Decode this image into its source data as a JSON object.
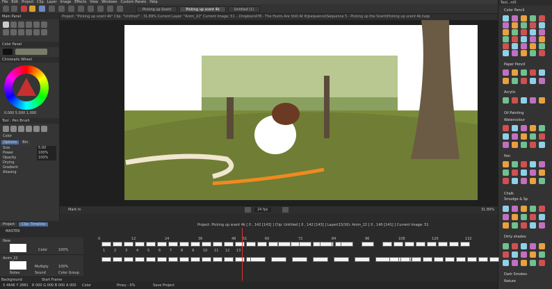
{
  "menu": [
    "File",
    "Edit",
    "Project",
    "Clip",
    "Layer",
    "Image",
    "Effects",
    "View",
    "Windows",
    "Custom Panels",
    "Help"
  ],
  "tabs": [
    "Picking up Scent",
    "Picking up scent 4k",
    "Untitled (1)"
  ],
  "status_line": "Project: \"Picking up scent 4k\" Clip: \"Untitled\" : 31.89% Current Layer: \"Anim_22\" Current Image: 51 ...Dropbox\\478 - The Hunts Are Shill At It\\Jsequence\\Sequence 5 - Picking up the Scent\\Picking up scent 4k.tvpp",
  "left_panel": {
    "main_panel": "Main Panel",
    "color_panel": "Color Panel",
    "chromatic_wheel": "Chromatic Wheel",
    "coords": "0.000 5.000 1.000",
    "tool_title": "Tool : Pen Brush",
    "color_label": "Color",
    "options_tab": "Options",
    "bin_tab": "Bin",
    "props": [
      {
        "label": "Size",
        "value": "5.00"
      },
      {
        "label": "Power",
        "value": "100%"
      },
      {
        "label": "Opacity",
        "value": "100%"
      },
      {
        "label": "Drying",
        "value": ""
      },
      {
        "label": "Gradient",
        "value": ""
      },
      {
        "label": "Aliasing",
        "value": ""
      }
    ]
  },
  "right_panel": {
    "title": "Tool...nt5",
    "sections": [
      "Color Pencil",
      "Paper Pencil",
      "Acrylic",
      "Oil Painting",
      "Watercolour",
      "Pen",
      "Chalk",
      "Smudge & Sp",
      "Dirty shadov",
      "Dark Smokes",
      "Nature"
    ]
  },
  "transport": {
    "mark_in": "Mark In",
    "fps": "24 fps",
    "zoom": "31.89%"
  },
  "timeline": {
    "tabs": [
      "Project",
      "Clip: Timeline"
    ],
    "master": "MASTER",
    "info": "Project: Picking up scent 4k [ 0 , 142 [143] ]      Clip: Untitled [ 0 , 142 [143] ]      Layer(15/16): Anim_22 [ 0 , 140 [141] ]      Current Image: 51",
    "layers": [
      {
        "name": "New",
        "label": "Color",
        "opacity": "100%"
      },
      {
        "name": "Anim_22",
        "label": "Multiply",
        "opacity": "100%",
        "notes": "Notes",
        "sound": "Sound",
        "group": "Color Group"
      }
    ],
    "background": "Background",
    "start_frame": "Start Frame",
    "ruler": [
      "0",
      "12",
      "24",
      "36",
      "48",
      "51",
      "60",
      "72",
      "84",
      "96",
      "108",
      "120",
      "132"
    ],
    "cell_nums": [
      "1",
      "2",
      "3",
      "4",
      "5",
      "6",
      "7",
      "8",
      "9",
      "10",
      "11",
      "12",
      "13"
    ]
  },
  "bottom_status": {
    "coords": "X 4646 Y 2881",
    "values": "R 000 G 000 B 000 A 000",
    "color": "Color",
    "proxy": "Proxy : 0%",
    "save": "Save Project"
  }
}
